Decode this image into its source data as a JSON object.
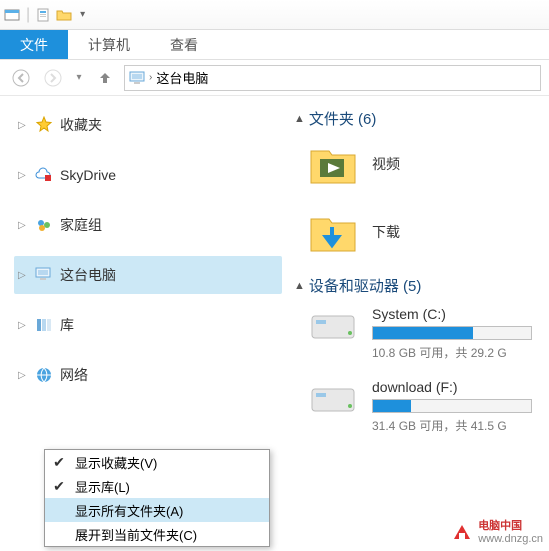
{
  "titlebar": {
    "dropdown": "▾"
  },
  "tabs": {
    "file": "文件",
    "computer": "计算机",
    "view": "查看"
  },
  "address": {
    "location": "这台电脑",
    "chev": "›"
  },
  "sidebar": {
    "items": [
      {
        "label": "收藏夹"
      },
      {
        "label": "SkyDrive"
      },
      {
        "label": "家庭组"
      },
      {
        "label": "这台电脑"
      },
      {
        "label": "库"
      },
      {
        "label": "网络"
      }
    ]
  },
  "groups": {
    "folders_label": "文件夹 (6)",
    "drives_label": "设备和驱动器 (5)"
  },
  "folders": [
    {
      "name": "视频"
    },
    {
      "name": "下载"
    }
  ],
  "drives": [
    {
      "name": "System (C:)",
      "free_text": "10.8 GB 可用，共 29.2 G",
      "fill_pct": 63
    },
    {
      "name": "download (F:)",
      "free_text": "31.4 GB 可用，共 41.5 G",
      "fill_pct": 24
    }
  ],
  "context_menu": {
    "items": [
      {
        "label": "显示收藏夹(V)",
        "checked": true
      },
      {
        "label": "显示库(L)",
        "checked": true
      },
      {
        "label": "显示所有文件夹(A)",
        "checked": false,
        "highlight": true
      },
      {
        "label": "展开到当前文件夹(C)",
        "checked": false
      }
    ]
  },
  "watermark": {
    "brand": "电脑中国",
    "url": "www.dnzg.cn"
  }
}
